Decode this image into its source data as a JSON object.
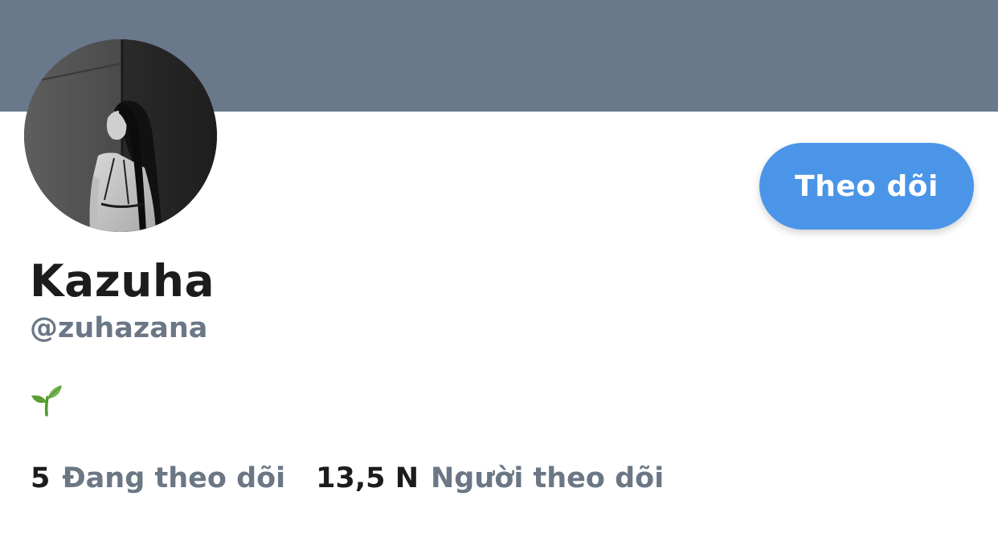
{
  "profile": {
    "display_name": "Kazuha",
    "handle": "@zuhazana",
    "bio_emoji_icon": "seedling-icon",
    "follow_button_label": "Theo dõi"
  },
  "stats": {
    "following_count": "5",
    "following_label": "Đang theo dõi",
    "followers_count": "13,5 N",
    "followers_label": "Người theo dõi"
  },
  "colors": {
    "banner": "#69788a",
    "accent": "#4a95e8",
    "text_primary": "#1c1c1e",
    "text_secondary": "#6b7785"
  }
}
